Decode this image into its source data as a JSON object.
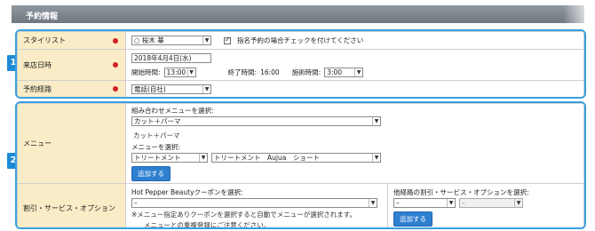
{
  "header": {
    "title": "予約情報"
  },
  "badges": [
    "1",
    "2"
  ],
  "section1": {
    "stylist": {
      "label": "スタイリスト",
      "selected": "○ 桜木 華",
      "checkbox_label": "指名予約の場合チェックを付けてください",
      "checked": true
    },
    "visit": {
      "label": "来店日時",
      "date_value": "2018年4月4日(水)",
      "start_label": "開始時間:",
      "start_value": "13:00",
      "end_label": "終了時間:",
      "end_value": "16:00",
      "duration_label": "施術時間:",
      "duration_value": "3:00"
    },
    "route": {
      "label": "予約経路",
      "selected": "電話(自社)"
    }
  },
  "section2": {
    "menu": {
      "label": "メニュー",
      "combo_heading": "組み合わせメニューを選択:",
      "combo_selected": "カット＋パーマ",
      "combo_note": "カット＋パーマ",
      "menu_heading": "メニューを選択:",
      "menu_category": "トリートメント",
      "menu_item": "トリートメント　Aujua　ショート",
      "add_button": "追加する"
    },
    "discount": {
      "label": "割引・サービス・オプション",
      "hpb_heading": "Hot Pepper Beautyクーポンを選択:",
      "hpb_selected": "–",
      "note_line1": "※メニュー指定ありクーポンを選択すると自動でメニューが選択されます。",
      "note_line2": "メニューとの重複登録にご注意ください。",
      "other_heading": "他経路の割引・サービス・オプションを選択:",
      "other_selected1": "–",
      "other_selected2": "–",
      "add_button": "追加する"
    }
  },
  "colors": {
    "accent": "#3aa0e0",
    "label_bg": "#f9ecc6",
    "required": "#d42020",
    "button": "#2f7fd0"
  }
}
